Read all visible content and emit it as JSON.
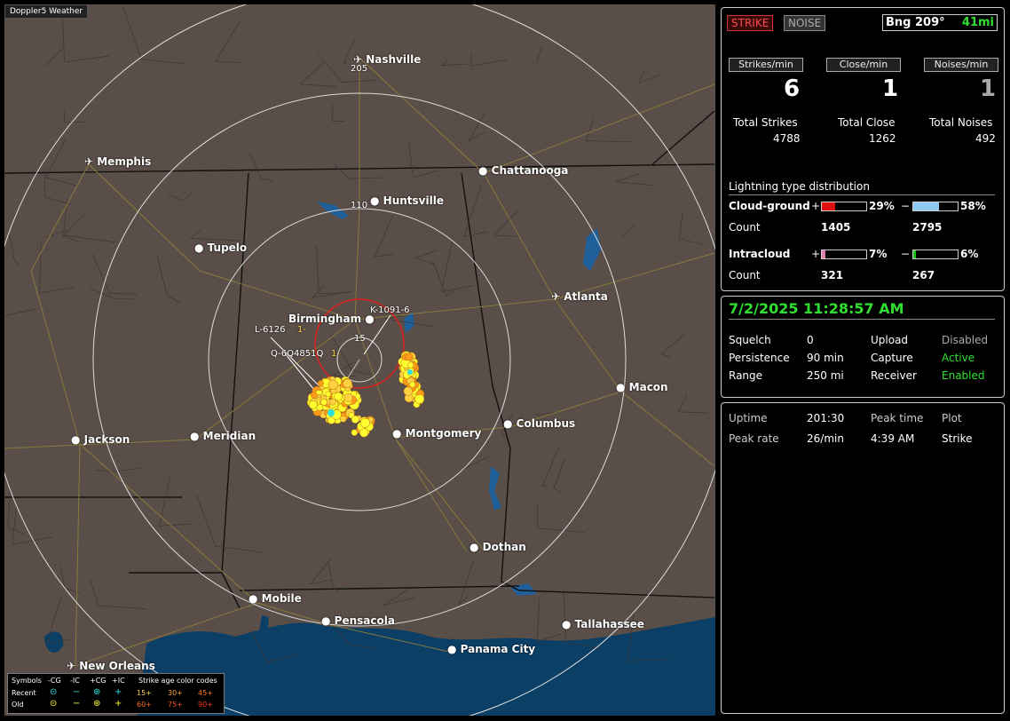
{
  "window_title": "Doppler5 Weather",
  "map": {
    "cities": [
      {
        "name": "Nashville",
        "icon": "airport-icon"
      },
      {
        "name": "Memphis",
        "icon": "airport-icon"
      },
      {
        "name": "Chattanooga",
        "icon": "city-dot-icon"
      },
      {
        "name": "Huntsville",
        "icon": "city-dot-icon"
      },
      {
        "name": "Tupelo",
        "icon": "city-dot-icon"
      },
      {
        "name": "Atlanta",
        "icon": "airport-icon"
      },
      {
        "name": "Birmingham",
        "icon": "city-dot-icon"
      },
      {
        "name": "Macon",
        "icon": "city-dot-icon"
      },
      {
        "name": "Columbus",
        "icon": "city-dot-icon"
      },
      {
        "name": "Jackson",
        "icon": "city-dot-icon"
      },
      {
        "name": "Meridian",
        "icon": "city-dot-icon"
      },
      {
        "name": "Montgomery",
        "icon": "city-dot-icon"
      },
      {
        "name": "Dothan",
        "icon": "city-dot-icon"
      },
      {
        "name": "Mobile",
        "icon": "city-dot-icon"
      },
      {
        "name": "Pensacola",
        "icon": "city-dot-icon"
      },
      {
        "name": "Tallahassee",
        "icon": "city-dot-icon"
      },
      {
        "name": "Panama City",
        "icon": "city-dot-icon"
      },
      {
        "name": "New Orleans",
        "icon": "airport-icon"
      }
    ],
    "range_labels": [
      "205",
      "110",
      "15"
    ],
    "storm_labels": [
      "K-1091-6",
      "L-6126",
      "Q-6Q4851Q"
    ],
    "storm_label_suffix": [
      "1-",
      "1-"
    ],
    "colors": {
      "land": "#5a4e49",
      "water": "#0b3f66",
      "roads": "#8a7a3c",
      "borders": "#111111",
      "ring": "#dddddd",
      "close_ring": "#e02020",
      "strike_yellow": "#ffff30",
      "strike_orange": "#ff9a1a"
    }
  },
  "legend": {
    "symbols_label": "Symbols",
    "headers": [
      "-CG",
      "-IC",
      "+CG",
      "+IC"
    ],
    "age_label": "Strike age color codes",
    "rows": [
      {
        "label": "Recent",
        "ages": [
          "15+",
          "30+",
          "45+"
        ]
      },
      {
        "label": "Old",
        "ages": [
          "60+",
          "75+",
          "90+"
        ]
      }
    ]
  },
  "top_panel": {
    "strike_btn": "STRIKE",
    "noise_btn": "NOISE",
    "bearing_label": "Bng 209°",
    "distance_label": "41mi",
    "rate_headers": [
      "Strikes/min",
      "Close/min",
      "Noises/min"
    ],
    "rates": [
      "6",
      "1",
      "1"
    ],
    "total_labels": [
      "Total Strikes",
      "Total Close",
      "Total Noises"
    ],
    "totals": [
      "4788",
      "1262",
      "492"
    ],
    "distribution_title": "Lightning type distribution",
    "cloud_ground": {
      "label": "Cloud-ground",
      "plus_pct_text": "29%",
      "plus_pct": 29,
      "minus_pct_text": "58%",
      "minus_pct": 58,
      "count_label": "Count",
      "plus_count": "1405",
      "minus_count": "2795",
      "plus_color": "#e01010",
      "minus_color": "#8fc8f0"
    },
    "intracloud": {
      "label": "Intracloud",
      "plus_pct_text": "7%",
      "plus_pct": 7,
      "minus_pct_text": "6%",
      "minus_pct": 6,
      "count_label": "Count",
      "plus_count": "321",
      "minus_count": "267",
      "plus_color": "#e080b0",
      "minus_color": "#20c020"
    },
    "plus_sign": "+",
    "minus_sign": "−"
  },
  "status_panel": {
    "datetime": "7/2/2025 11:28:57 AM",
    "rows": [
      {
        "k1": "Squelch",
        "v1": "0",
        "k2": "Upload",
        "v2": "Disabled"
      },
      {
        "k1": "Persistence",
        "v1": "90 min",
        "k2": "Capture",
        "v2": "Active"
      },
      {
        "k1": "Range",
        "v1": "250 mi",
        "k2": "Receiver",
        "v2": "Enabled"
      }
    ]
  },
  "stats_panel": {
    "row1": {
      "k1": "Uptime",
      "v1": "201:30",
      "k2": "Peak time",
      "v2": "Plot"
    },
    "row2": {
      "k1": "Peak rate",
      "v1": "26/min",
      "k2": "4:39 AM",
      "v2": "Strike"
    }
  }
}
